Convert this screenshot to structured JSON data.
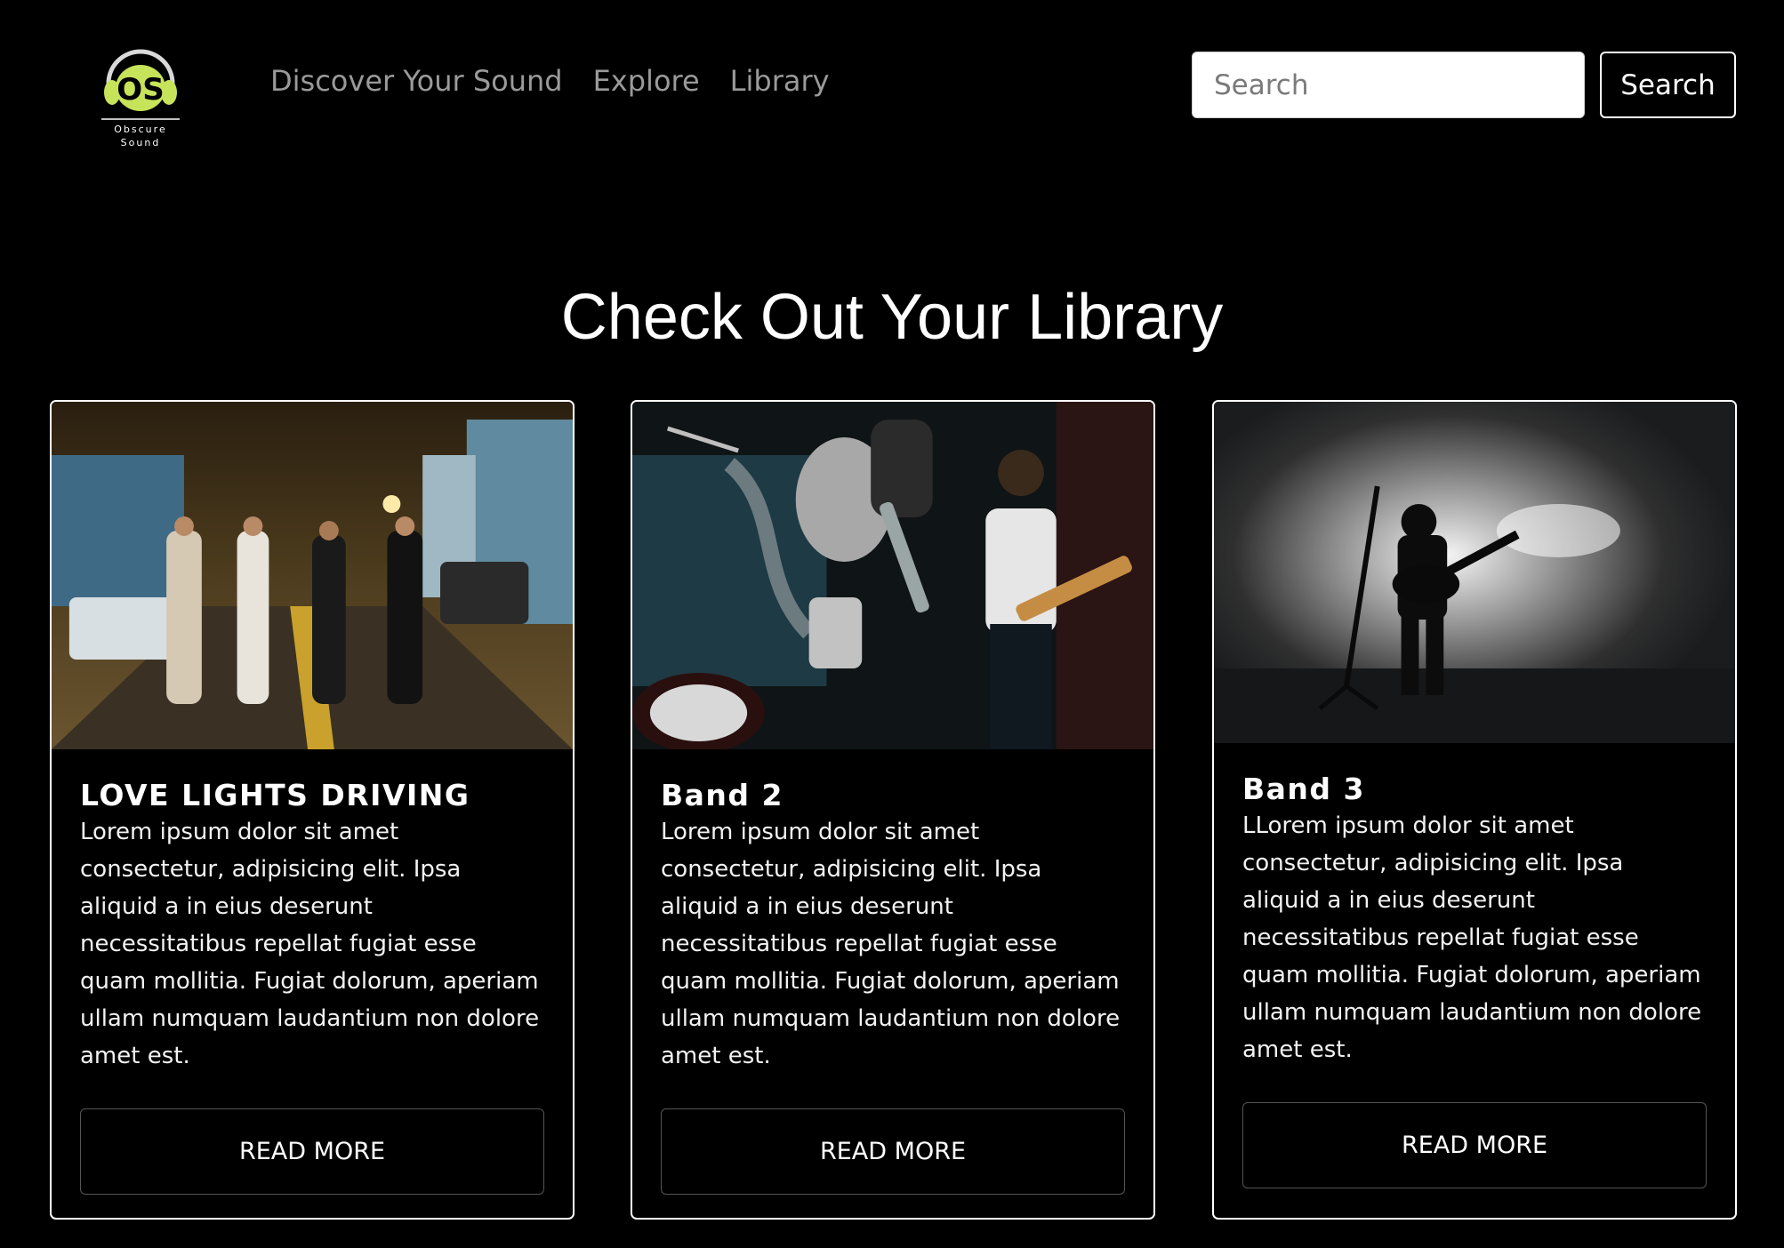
{
  "logo": {
    "initials": "OS",
    "line1": "Obscure",
    "line2": "Sound",
    "accent": "#c6e35a"
  },
  "nav": {
    "links": [
      "Discover Your Sound",
      "Explore",
      "Library"
    ],
    "link_color": "#9a9a9a"
  },
  "search": {
    "placeholder": "Search",
    "button_label": "Search"
  },
  "page": {
    "title": "Check Out Your Library"
  },
  "cards": [
    {
      "title": "LOVE LIGHTS DRIVING",
      "text": "Lorem ipsum dolor sit amet consectetur, adipisicing elit. Ipsa aliquid a in eius deserunt necessitatibus repellat fugiat esse quam mollitia. Fugiat dolorum, aperiam ullam numquam laudantium non dolore amet est.",
      "button": "READ MORE",
      "image": "band-street-night-photo"
    },
    {
      "title": "Band 2",
      "text": "Lorem ipsum dolor sit amet consectetur, adipisicing elit. Ipsa aliquid a in eius deserunt necessitatibus repellat fugiat esse quam mollitia. Fugiat dolorum, aperiam ullam numquam laudantium non dolore amet est.",
      "button": "READ MORE",
      "image": "band-live-stage-photo"
    },
    {
      "title": "Band 3",
      "text": "LLorem ipsum dolor sit amet consectetur, adipisicing elit. Ipsa aliquid a in eius deserunt necessitatibus repellat fugiat esse quam mollitia. Fugiat dolorum, aperiam ullam numquam laudantium non dolore amet est.",
      "button": "READ MORE",
      "image": "guitarist-silhouette-smoke-photo"
    }
  ]
}
